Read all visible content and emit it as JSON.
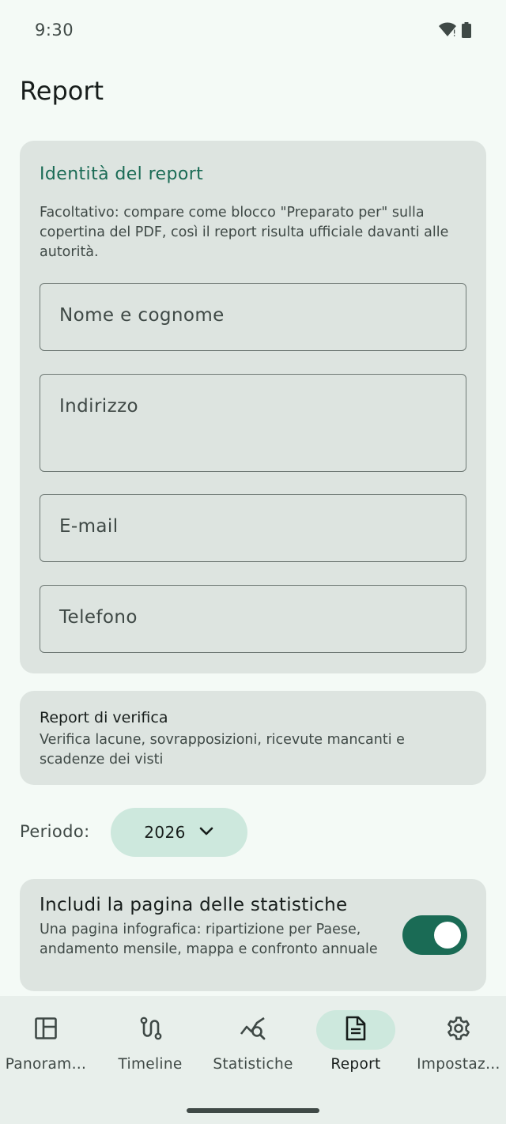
{
  "status_bar": {
    "time": "9:30"
  },
  "page": {
    "title": "Report"
  },
  "identity": {
    "title": "Identità del report",
    "description": "Facoltativo: compare come blocco \"Preparato per\" sulla copertina del PDF, così il report risulta ufficiale davanti alle autorità.",
    "fields": {
      "name": "Nome e cognome",
      "address": "Indirizzo",
      "email": "E-mail",
      "phone": "Telefono"
    }
  },
  "verification": {
    "title": "Report di verifica",
    "subtitle": "Verifica lacune, sovrapposizioni, ricevute mancanti e scadenze dei visti"
  },
  "period": {
    "label": "Periodo:",
    "value": "2026"
  },
  "stats_option": {
    "title": "Includi la pagina delle statistiche",
    "subtitle": "Una pagina infografica: ripartizione per Paese, andamento mensile, mappa e confronto annuale",
    "enabled": true
  },
  "nav": {
    "items": [
      {
        "label": "Panoram…",
        "icon": "dashboard-icon"
      },
      {
        "label": "Timeline",
        "icon": "route-icon"
      },
      {
        "label": "Statistiche",
        "icon": "query-stats-icon"
      },
      {
        "label": "Report",
        "icon": "document-icon",
        "active": true
      },
      {
        "label": "Impostaz…",
        "icon": "gear-icon"
      }
    ]
  },
  "colors": {
    "background": "#f4faf6",
    "card": "#dde4e0",
    "accent": "#1a6b55",
    "chip": "#cde8dd",
    "nav": "#e8efeb"
  }
}
